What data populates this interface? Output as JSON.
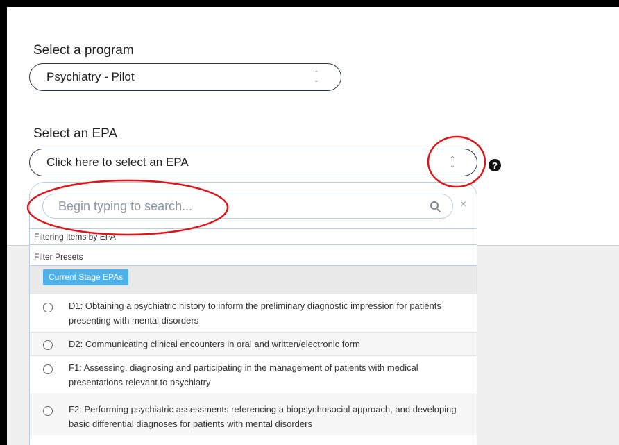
{
  "program": {
    "label": "Select a program",
    "selected": "Psychiatry - Pilot"
  },
  "epa": {
    "label": "Select an EPA",
    "placeholder": "Click here to select an EPA",
    "help_icon": "?"
  },
  "dropdown": {
    "search_placeholder": "Begin typing to search...",
    "clear_icon": "×",
    "filtering_label": "Filtering Items by EPA",
    "presets_label": "Filter Presets",
    "preset_button": "Current Stage EPAs",
    "items": [
      {
        "text": "D1: Obtaining a psychiatric history to inform the preliminary diagnostic impression for patients presenting with mental disorders"
      },
      {
        "text": "D2: Communicating clinical encounters in oral and written/electronic form"
      },
      {
        "text": "F1: Assessing, diagnosing and participating in the management of patients with medical presentations relevant to psychiatry"
      },
      {
        "text": "F2: Performing psychiatric assessments referencing a biopsychosocial approach, and developing basic differential diagnoses for patients with mental disorders"
      }
    ]
  },
  "colors": {
    "annotation": "#e0151a",
    "accent": "#4eb1ea"
  }
}
